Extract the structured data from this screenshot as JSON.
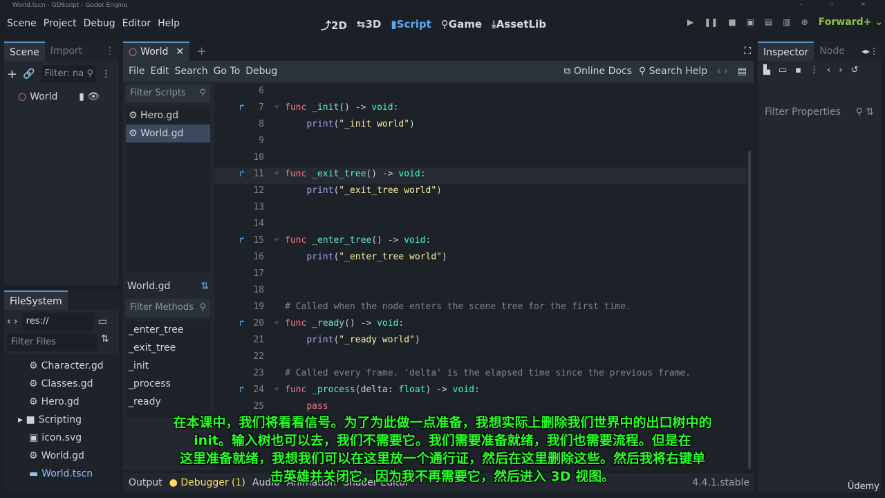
{
  "window": {
    "title": "World.tscn - GDScript - Godot Engine",
    "controls": "–  ▫  ✕"
  },
  "menu": [
    "Scene",
    "Project",
    "Debug",
    "Editor",
    "Help"
  ],
  "modes": [
    {
      "icon": "⤴",
      "label": "2D"
    },
    {
      "icon": "⇆",
      "label": "3D"
    },
    {
      "icon": "▮",
      "label": "Script"
    },
    {
      "icon": "⚲",
      "label": "Game"
    },
    {
      "icon": "⤓",
      "label": "AssetLib"
    }
  ],
  "run": {
    "icons": [
      "▶",
      "❚❚",
      "■",
      "▣",
      "▤",
      "▥",
      "⊛"
    ],
    "renderer": "Forward+ ⌄"
  },
  "scene_dock": {
    "tabs": [
      "Scene",
      "Import"
    ],
    "filter": "Filter: na",
    "root": "World"
  },
  "filesystem": {
    "tab": "FileSystem",
    "path": "res://",
    "filter": "Filter Files",
    "items": [
      {
        "name": "Character.gd",
        "icon": "⚙"
      },
      {
        "name": "Classes.gd",
        "icon": "⚙"
      },
      {
        "name": "Hero.gd",
        "icon": "⚙"
      },
      {
        "name": "Scripting",
        "icon": "▸ ■"
      },
      {
        "name": "icon.svg",
        "icon": "▣"
      },
      {
        "name": "World.gd",
        "icon": "⚙"
      },
      {
        "name": "World.tscn",
        "icon": "▬"
      }
    ]
  },
  "editor_tab": {
    "label": "World",
    "add": "+"
  },
  "script_menu": [
    "File",
    "Edit",
    "Search",
    "Go To",
    "Debug"
  ],
  "script_tools": {
    "docs": "Online Docs",
    "help": "Search Help"
  },
  "scripts": {
    "filter": "Filter Scripts",
    "items": [
      "Hero.gd",
      "World.gd"
    ],
    "current": "World.gd",
    "method_filter": "Filter Methods",
    "methods": [
      "_enter_tree",
      "_exit_tree",
      "_init",
      "_process",
      "_ready"
    ]
  },
  "code": [
    {
      "n": "6",
      "seg": []
    },
    {
      "n": "7",
      "ov": true,
      "seg": [
        [
          "func ",
          "kw"
        ],
        [
          "_init",
          "fn"
        ],
        [
          "() -> ",
          "pl"
        ],
        [
          "void",
          "ty"
        ],
        [
          ":",
          "pl"
        ]
      ]
    },
    {
      "n": "8",
      "seg": [
        [
          "    ",
          "pl"
        ],
        [
          "print",
          "bi"
        ],
        [
          "(",
          "pl"
        ],
        [
          "\"_init world\"",
          "str"
        ],
        [
          ")",
          "pl"
        ]
      ]
    },
    {
      "n": "9",
      "seg": []
    },
    {
      "n": "10",
      "seg": []
    },
    {
      "n": "11",
      "ov": true,
      "seg": [
        [
          "func ",
          "kw"
        ],
        [
          "_exit_tree",
          "fn"
        ],
        [
          "() -> ",
          "pl"
        ],
        [
          "void",
          "ty"
        ],
        [
          ":",
          "pl"
        ]
      ]
    },
    {
      "n": "12",
      "seg": [
        [
          "    ",
          "pl"
        ],
        [
          "print",
          "bi"
        ],
        [
          "(",
          "pl"
        ],
        [
          "\"_exit_tree world\"",
          "str"
        ],
        [
          ")",
          "pl"
        ]
      ]
    },
    {
      "n": "13",
      "seg": []
    },
    {
      "n": "14",
      "seg": []
    },
    {
      "n": "15",
      "ov": true,
      "seg": [
        [
          "func ",
          "kw"
        ],
        [
          "_enter_tree",
          "fn"
        ],
        [
          "() -> ",
          "pl"
        ],
        [
          "void",
          "ty"
        ],
        [
          ":",
          "pl"
        ]
      ]
    },
    {
      "n": "16",
      "seg": [
        [
          "    ",
          "pl"
        ],
        [
          "print",
          "bi"
        ],
        [
          "(",
          "pl"
        ],
        [
          "\"_enter_tree world\"",
          "str"
        ],
        [
          ")",
          "pl"
        ]
      ]
    },
    {
      "n": "17",
      "seg": []
    },
    {
      "n": "18",
      "seg": []
    },
    {
      "n": "19",
      "seg": [
        [
          "# Called when the node enters the scene tree for the first time.",
          "cm"
        ]
      ]
    },
    {
      "n": "20",
      "ov": true,
      "seg": [
        [
          "func ",
          "kw"
        ],
        [
          "_ready",
          "fn"
        ],
        [
          "() -> ",
          "pl"
        ],
        [
          "void",
          "ty"
        ],
        [
          ":",
          "pl"
        ]
      ]
    },
    {
      "n": "21",
      "seg": [
        [
          "    ",
          "pl"
        ],
        [
          "print",
          "bi"
        ],
        [
          "(",
          "pl"
        ],
        [
          "\"_ready world\"",
          "str"
        ],
        [
          ")",
          "pl"
        ]
      ]
    },
    {
      "n": "22",
      "seg": []
    },
    {
      "n": "23",
      "seg": [
        [
          "# Called every frame. 'delta' is the elapsed time since the previous frame.",
          "cm"
        ]
      ]
    },
    {
      "n": "24",
      "ov": true,
      "seg": [
        [
          "func ",
          "kw"
        ],
        [
          "_process",
          "fn"
        ],
        [
          "(delta: ",
          "pl"
        ],
        [
          "float",
          "ty"
        ],
        [
          ") -> ",
          "pl"
        ],
        [
          "void",
          "ty"
        ],
        [
          ":",
          "pl"
        ]
      ]
    },
    {
      "n": "25",
      "seg": [
        [
          "    ",
          "pl"
        ],
        [
          "pass",
          "kw"
        ]
      ]
    }
  ],
  "inspector": {
    "tabs": [
      "Inspector",
      "Node"
    ],
    "filter": "Filter Properties"
  },
  "bottom": {
    "tabs": [
      "Output",
      "Debugger (1)",
      "Audio",
      "Animation",
      "Shader Editor"
    ],
    "version": "4.4.1.stable"
  },
  "subtitles": [
    "在本课中，我们将看看信号。为了为此做一点准备，我想实际上删除我们世界中的出口树中的",
    "init。输入树也可以去，我们不需要它。我们需要准备就绪，我们也需要流程。但是在",
    "这里准备就绪，我想我们可以在这里放一个通行证，然后在这里删除这些。然后我将右键单",
    "击英雄并关闭它，因为我不再需要它，然后进入 3D 视图。"
  ],
  "watermark": "Ûdemy"
}
